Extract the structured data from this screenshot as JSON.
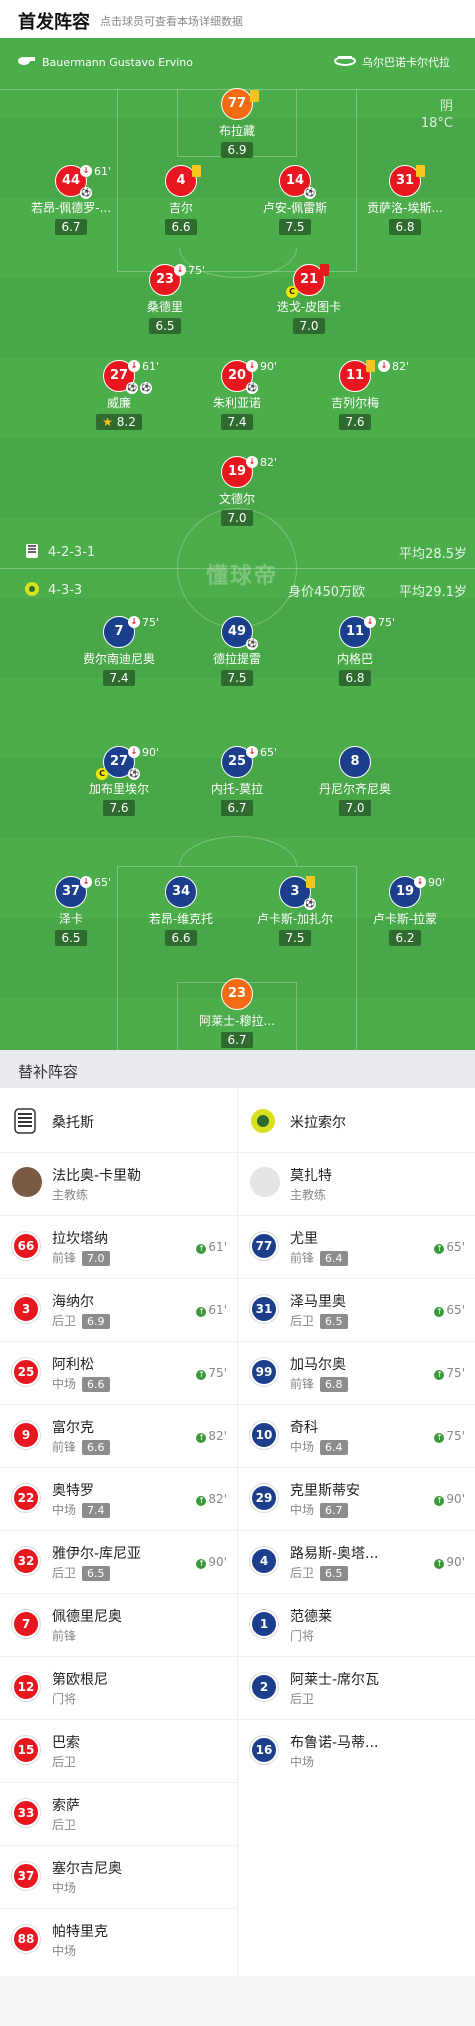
{
  "header": {
    "title": "首发阵容",
    "subtitle": "点击球员可查看本场详细数据"
  },
  "pitch": {
    "referee": "Bauermann Gustavo Ervino",
    "venue": "乌尔巴诺卡尔代拉",
    "weather": "阴",
    "temperature": "18°C",
    "watermark": "懂球帝",
    "home": {
      "formation": "4-2-3-1",
      "avg_age": "平均28.5岁"
    },
    "away": {
      "formation": "4-3-3",
      "market_value": "身价450万欧",
      "avg_age": "平均29.1岁"
    },
    "players": [
      {
        "num": "77",
        "name": "布拉藏",
        "rating": "6.9"
      },
      {
        "num": "44",
        "name": "若昂-佩德罗-...",
        "rating": "6.7",
        "minute": "61'"
      },
      {
        "num": "4",
        "name": "吉尔",
        "rating": "6.6"
      },
      {
        "num": "14",
        "name": "卢安-佩雷斯",
        "rating": "7.5"
      },
      {
        "num": "31",
        "name": "贡萨洛-埃斯...",
        "rating": "6.8"
      },
      {
        "num": "23",
        "name": "桑德里",
        "rating": "6.5",
        "minute": "75'"
      },
      {
        "num": "21",
        "name": "迭戈-皮图卡",
        "rating": "7.0"
      },
      {
        "num": "27",
        "name": "威廉",
        "rating": "8.2",
        "minute": "61'"
      },
      {
        "num": "20",
        "name": "朱利亚诺",
        "rating": "7.4",
        "minute": "90'"
      },
      {
        "num": "11",
        "name": "吉列尔梅",
        "rating": "7.6",
        "minute": "82'"
      },
      {
        "num": "19",
        "name": "文德尔",
        "rating": "7.0",
        "minute": "82'"
      },
      {
        "num": "7",
        "name": "费尔南迪尼奥",
        "rating": "7.4",
        "minute": "75'"
      },
      {
        "num": "49",
        "name": "德拉提雷",
        "rating": "7.5"
      },
      {
        "num": "11",
        "name": "内格巴",
        "rating": "6.8",
        "minute": "75'"
      },
      {
        "num": "27",
        "name": "加布里埃尔",
        "rating": "7.6",
        "minute": "90'"
      },
      {
        "num": "25",
        "name": "内托-莫拉",
        "rating": "6.7",
        "minute": "65'"
      },
      {
        "num": "8",
        "name": "丹尼尔齐尼奥",
        "rating": "7.0"
      },
      {
        "num": "37",
        "name": "泽卡",
        "rating": "6.5",
        "minute": "65'"
      },
      {
        "num": "34",
        "name": "若昂-维克托",
        "rating": "6.6"
      },
      {
        "num": "3",
        "name": "卢卡斯-加扎尔",
        "rating": "7.5"
      },
      {
        "num": "19",
        "name": "卢卡斯-拉蒙",
        "rating": "6.2",
        "minute": "90'"
      },
      {
        "num": "23",
        "name": "阿莱士-穆拉...",
        "rating": "6.7"
      }
    ]
  },
  "bench_title": "替补阵容",
  "home_team": {
    "name": "桑托斯",
    "coach": {
      "name": "法比奥-卡里勒",
      "role": "主教练"
    },
    "subs": [
      {
        "num": "66",
        "name": "拉坎塔纳",
        "pos": "前锋",
        "rating": "7.0",
        "minute": "61'"
      },
      {
        "num": "3",
        "name": "海纳尔",
        "pos": "后卫",
        "rating": "6.9",
        "minute": "61'"
      },
      {
        "num": "25",
        "name": "阿利松",
        "pos": "中场",
        "rating": "6.6",
        "minute": "75'"
      },
      {
        "num": "9",
        "name": "富尔克",
        "pos": "前锋",
        "rating": "6.6",
        "minute": "82'"
      },
      {
        "num": "22",
        "name": "奥特罗",
        "pos": "中场",
        "rating": "7.4",
        "minute": "82'"
      },
      {
        "num": "32",
        "name": "雅伊尔-库尼亚",
        "pos": "后卫",
        "rating": "6.5",
        "minute": "90'"
      },
      {
        "num": "7",
        "name": "佩德里尼奥",
        "pos": "前锋"
      },
      {
        "num": "12",
        "name": "第欧根尼",
        "pos": "门将"
      },
      {
        "num": "15",
        "name": "巴索",
        "pos": "后卫"
      },
      {
        "num": "33",
        "name": "索萨",
        "pos": "后卫"
      },
      {
        "num": "37",
        "name": "塞尔吉尼奥",
        "pos": "中场"
      },
      {
        "num": "88",
        "name": "帕特里克",
        "pos": "中场"
      }
    ]
  },
  "away_team": {
    "name": "米拉索尔",
    "coach": {
      "name": "莫扎特",
      "role": "主教练"
    },
    "subs": [
      {
        "num": "77",
        "name": "尤里",
        "pos": "前锋",
        "rating": "6.4",
        "minute": "65'"
      },
      {
        "num": "31",
        "name": "泽马里奥",
        "pos": "后卫",
        "rating": "6.5",
        "minute": "65'"
      },
      {
        "num": "99",
        "name": "加马尔奥",
        "pos": "前锋",
        "rating": "6.8",
        "minute": "75'"
      },
      {
        "num": "10",
        "name": "奇科",
        "pos": "中场",
        "rating": "6.4",
        "minute": "75'"
      },
      {
        "num": "29",
        "name": "克里斯蒂安",
        "pos": "中场",
        "rating": "6.7",
        "minute": "90'"
      },
      {
        "num": "4",
        "name": "路易斯-奥塔...",
        "pos": "后卫",
        "rating": "6.5",
        "minute": "90'"
      },
      {
        "num": "1",
        "name": "范德莱",
        "pos": "门将"
      },
      {
        "num": "2",
        "name": "阿莱士-席尔瓦",
        "pos": "后卫"
      },
      {
        "num": "16",
        "name": "布鲁诺-马蒂...",
        "pos": "中场"
      }
    ]
  },
  "colors": {
    "pitch": "#48a847",
    "home": "#e7161f",
    "away": "#1b3f8c",
    "keeper": "#f36b12"
  },
  "icons": [
    "whistle-icon",
    "stadium-icon",
    "substitution-icon",
    "yellow-card-icon",
    "red-card-icon",
    "goal-ball-icon",
    "captain-icon",
    "assist-icon",
    "star-icon",
    "team-crest-icon"
  ]
}
